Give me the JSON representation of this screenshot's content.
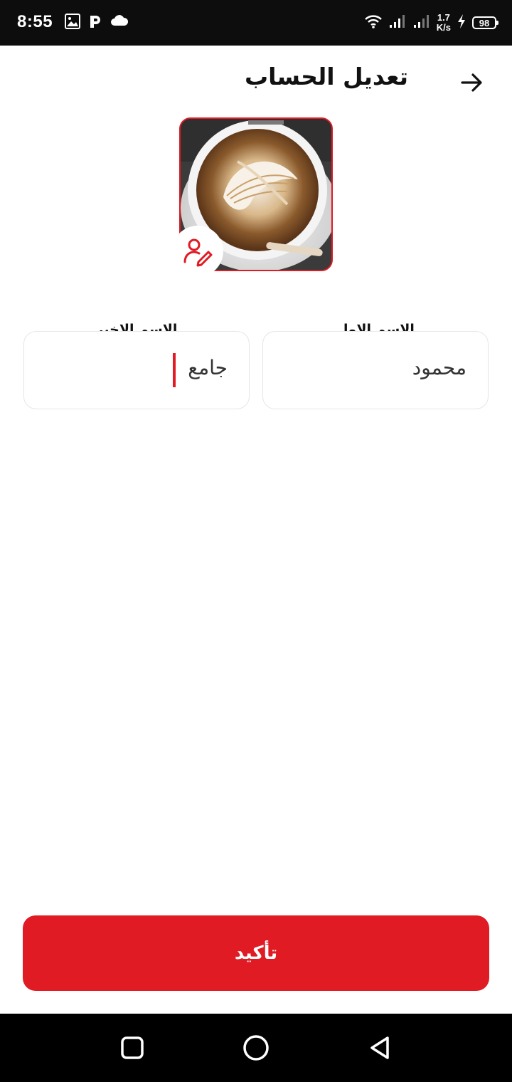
{
  "status_bar": {
    "time": "8:55",
    "net_speed_value": "1.7",
    "net_speed_unit": "K/s",
    "battery": "98"
  },
  "header": {
    "title": "تعديل الحساب",
    "back_icon": "arrow-right-icon"
  },
  "profile": {
    "avatar_image": "coffee-latte-art-photo",
    "edit_icon": "user-edit-icon"
  },
  "form": {
    "first_name": {
      "label": "الاسم الاول",
      "value": "محمود"
    },
    "last_name": {
      "label": "الاسم الاخير",
      "value": "جامع"
    }
  },
  "confirm_button": {
    "label": "تأكيد"
  },
  "nav_bar": {
    "recents_icon": "square-icon",
    "home_icon": "circle-icon",
    "back_icon": "triangle-back-icon"
  },
  "colors": {
    "accent": "#e01b24",
    "status_bar_bg": "#0d0d0d",
    "nav_bar_bg": "#000000",
    "field_border": "#e6e6e6"
  }
}
